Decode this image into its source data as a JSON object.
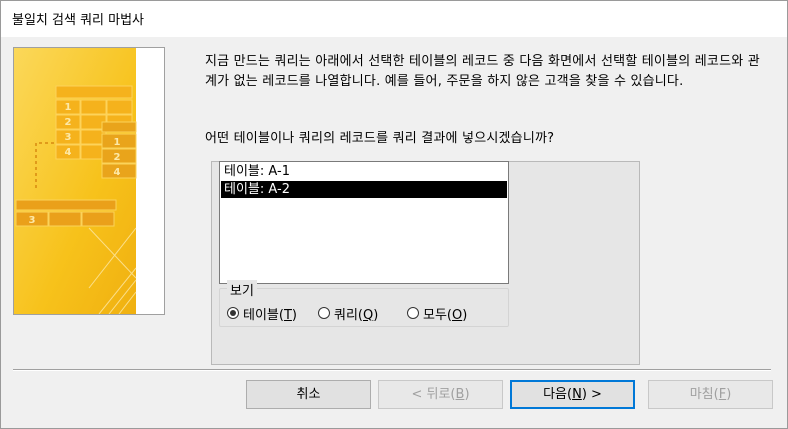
{
  "window": {
    "title": "불일치 검색 쿼리 마법사"
  },
  "illustration": {
    "name": "wizard-illustration",
    "numbers": [
      "1",
      "2",
      "3",
      "4",
      "1",
      "2",
      "4",
      "3"
    ]
  },
  "main": {
    "description": "지금 만드는 쿼리는 아래에서 선택한 테이블의 레코드 중 다음 화면에서 선택할 테이블의 레코드와 관계가 없는 레코드를 나열합니다. 예를 들어, 주문을 하지 않은 고객을 찾을 수 있습니다.",
    "question": "어떤 테이블이나 쿼리의 레코드를 쿼리 결과에 넣으시겠습니까?"
  },
  "list": {
    "items": [
      {
        "label": "테이블: A-1",
        "selected": false
      },
      {
        "label": "테이블: A-2",
        "selected": true
      }
    ]
  },
  "view": {
    "legend": "보기",
    "options": [
      {
        "label": "테이블(",
        "key": "T",
        "suffix": ")",
        "checked": true
      },
      {
        "label": "쿼리(",
        "key": "Q",
        "suffix": ")",
        "checked": false
      },
      {
        "label": "모두(",
        "key": "O",
        "suffix": ")",
        "checked": false
      }
    ]
  },
  "buttons": {
    "cancel": "취소",
    "back_prefix": "< 뒤로(",
    "back_key": "B",
    "back_suffix": ")",
    "next_prefix": "다음(",
    "next_key": "N",
    "next_suffix": ") >",
    "finish_prefix": "마침(",
    "finish_key": "F",
    "finish_suffix": ")"
  },
  "colors": {
    "accent": "#0078d7",
    "illustration_yellow": "#f7c21b",
    "illustration_orange": "#e9a21a"
  }
}
